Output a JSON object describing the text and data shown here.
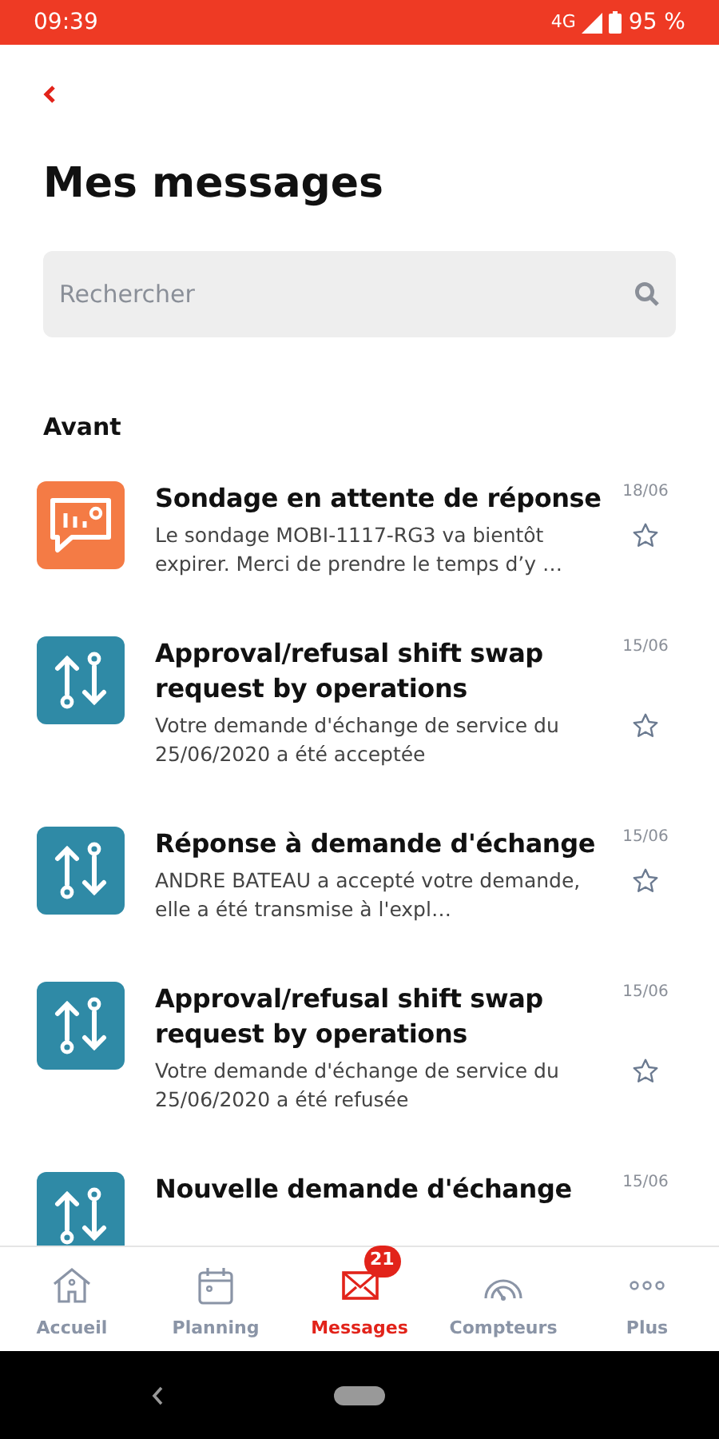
{
  "status_bar": {
    "time": "09:39",
    "network": "4G",
    "battery": "95 %"
  },
  "title": "Mes messages",
  "search": {
    "placeholder": "Rechercher"
  },
  "section": "Avant",
  "messages": [
    {
      "kind": "survey",
      "title": "Sondage en attente de réponse",
      "body": "Le sondage MOBI-1117-RG3 va bientôt expirer. Merci de prendre le temps d’y …",
      "date": "18/06",
      "starred": false
    },
    {
      "kind": "swap",
      "title": "Approval/refusal shift swap request by operations",
      "body": "Votre demande d'échange de service du 25/06/2020 a été acceptée",
      "date": "15/06",
      "starred": false
    },
    {
      "kind": "swap",
      "title": "Réponse à demande d'échange",
      "body": "ANDRE BATEAU a accepté votre demande, elle a été transmise à l'expl…",
      "date": "15/06",
      "starred": false
    },
    {
      "kind": "swap",
      "title": "Approval/refusal shift swap request by operations",
      "body": "Votre demande d'échange de service du 25/06/2020 a été refusée",
      "date": "15/06",
      "starred": false
    },
    {
      "kind": "swap",
      "title": "Nouvelle demande d'échange",
      "date": "15/06"
    }
  ],
  "nav": [
    {
      "kind": "home",
      "label": "Accueil",
      "selected": false
    },
    {
      "kind": "calendar",
      "label": "Planning",
      "selected": false
    },
    {
      "kind": "mail",
      "label": "Messages",
      "selected": true,
      "badge": "21"
    },
    {
      "kind": "gauge",
      "label": "Compteurs",
      "selected": false
    },
    {
      "kind": "more",
      "label": "Plus",
      "selected": false
    }
  ]
}
